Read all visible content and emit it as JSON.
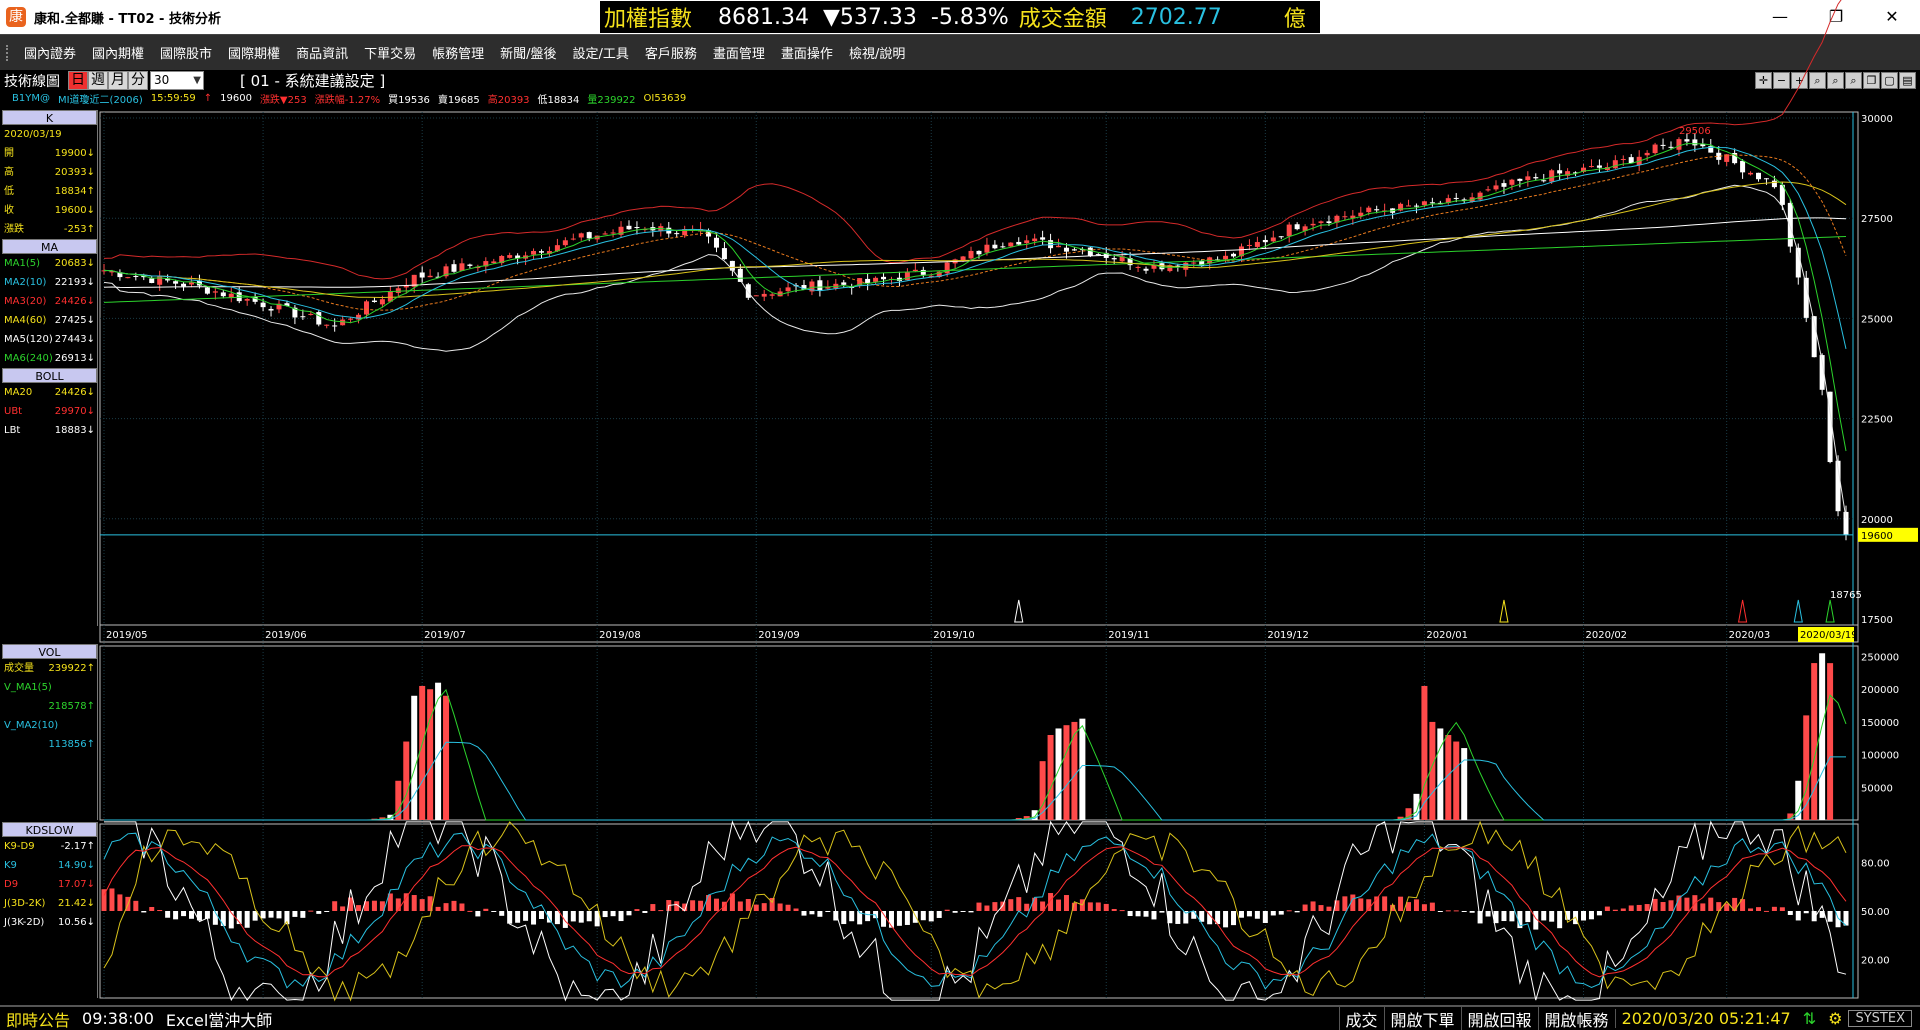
{
  "window": {
    "app_icon": "康",
    "title": "康和.全都賺 - TT02 - 技術分析",
    "minimize": "—",
    "maximize": "❐",
    "close": "✕"
  },
  "ticker": {
    "index_name": "加權指數",
    "index_value": "8681.34",
    "change": "▼537.33",
    "change_pct": "-5.83%",
    "turnover_label": "成交金額",
    "turnover_value": "2702.77",
    "unit": "億"
  },
  "menu": [
    "國內證券",
    "國內期權",
    "國際股市",
    "國際期權",
    "商品資訊",
    "下單交易",
    "帳務管理",
    "新聞/盤後",
    "設定/工具",
    "客戶服務",
    "畫面管理",
    "畫面操作",
    "檢視/說明"
  ],
  "toolbar": {
    "label": "技術線圖",
    "periods": [
      "日",
      "週",
      "月",
      "分"
    ],
    "active_period": "日",
    "select_value": "30",
    "setting_title": "[ 01 - 系統建議設定 ]"
  },
  "info": {
    "symbol": "B1YM@",
    "name": "MI道瓊近二(2006)",
    "time": "15:59:59",
    "arrow": "↑",
    "last": "19600",
    "change": "漲跌▼253",
    "change_pct": "漲跌幅-1.27%",
    "bid": "買19536",
    "ask": "賣19685",
    "high": "高20393",
    "low": "低18834",
    "volume": "量239922",
    "oi": "OI53639"
  },
  "panels": {
    "k": {
      "title": "K",
      "date": "2020/03/19",
      "rows": [
        {
          "k": "開",
          "v": "19900↓",
          "color": "#f5e21b"
        },
        {
          "k": "高",
          "v": "20393↓",
          "color": "#f5e21b"
        },
        {
          "k": "低",
          "v": "18834↑",
          "color": "#f5e21b"
        },
        {
          "k": "收",
          "v": "19600↓",
          "color": "#f5e21b"
        },
        {
          "k": "漲跌",
          "v": "-253↑",
          "color": "#f5e21b"
        }
      ]
    },
    "ma": {
      "title": "MA",
      "rows": [
        {
          "k": "MA1(5)",
          "v": "20683↓",
          "color": "#2cd32c",
          "vcolor": "#f5e21b"
        },
        {
          "k": "MA2(10)",
          "v": "22193↓",
          "color": "#29c0e0",
          "vcolor": "#fff"
        },
        {
          "k": "MA3(20)",
          "v": "24426↓",
          "color": "#ff3030",
          "vcolor": "#ff3030"
        },
        {
          "k": "MA4(60)",
          "v": "27425↓",
          "color": "#f5e21b",
          "vcolor": "#fff"
        },
        {
          "k": "MA5(120)",
          "v": "27443↓",
          "color": "#fff",
          "vcolor": "#fff"
        },
        {
          "k": "MA6(240)",
          "v": "26913↓",
          "color": "#2cd32c",
          "vcolor": "#fff"
        }
      ]
    },
    "boll": {
      "title": "BOLL",
      "rows": [
        {
          "k": "MA20",
          "v": "24426↓",
          "color": "#f5e21b",
          "vcolor": "#f5e21b"
        },
        {
          "k": "UBt",
          "v": "29970↓",
          "color": "#ff3030",
          "vcolor": "#ff3030"
        },
        {
          "k": "LBt",
          "v": "18883↓",
          "color": "#fff",
          "vcolor": "#fff"
        }
      ]
    },
    "vol": {
      "title": "VOL",
      "rows": [
        {
          "k": "成交量",
          "v": "239922↑",
          "color": "#f5e21b",
          "vcolor": "#f5e21b"
        },
        {
          "k": "V_MA1(5)",
          "v": "",
          "color": "#2cd32c",
          "vcolor": "#2cd32c"
        },
        {
          "k": "",
          "v": "218578↑",
          "color": "#2cd32c",
          "vcolor": "#2cd32c"
        },
        {
          "k": "V_MA2(10)",
          "v": "",
          "color": "#29c0e0",
          "vcolor": "#29c0e0"
        },
        {
          "k": "",
          "v": "113856↑",
          "color": "#29c0e0",
          "vcolor": "#29c0e0"
        }
      ]
    },
    "kd": {
      "title": "KDSLOW",
      "rows": [
        {
          "k": "K9-D9",
          "v": "-2.17↑",
          "color": "#f5e21b",
          "vcolor": "#fff"
        },
        {
          "k": "K9",
          "v": "14.90↓",
          "color": "#29c0e0",
          "vcolor": "#29c0e0"
        },
        {
          "k": "D9",
          "v": "17.07↓",
          "color": "#ff3030",
          "vcolor": "#ff3030"
        },
        {
          "k": "J(3D-2K)",
          "v": "21.42↓",
          "color": "#f5e21b",
          "vcolor": "#f5e21b"
        },
        {
          "k": "J(3K-2D)",
          "v": "10.56↓",
          "color": "#fff",
          "vcolor": "#fff"
        }
      ]
    }
  },
  "price_axis": [
    "30000",
    "27500",
    "25000",
    "22500",
    "20000",
    "17500"
  ],
  "price_flag": "19600",
  "price_low_label": "18765",
  "price_peak_label": "29506",
  "vol_axis": [
    "250000",
    "200000",
    "150000",
    "100000",
    "50000"
  ],
  "kd_axis": [
    "80.00",
    "50.00",
    "20.00"
  ],
  "dates": [
    "2019/05",
    "2019/06",
    "2019/07",
    "2019/08",
    "2019/09",
    "2019/10",
    "2019/11",
    "2019/12",
    "2020/01",
    "2020/02",
    "2020/03"
  ],
  "date_flag": "2020/03/19",
  "status": {
    "notice": "即時公告",
    "time": "09:38:00",
    "ad": "Excel當沖大師",
    "btn_trade": "成交",
    "btn_order": "開啟下單",
    "btn_report": "開啟回報",
    "btn_account": "開啟帳務",
    "clock": "2020/03/20 05:21:47",
    "logo": "SYSTEX"
  },
  "colors": {
    "up": "#ff4a4a",
    "down": "#ffffff",
    "grid": "#1a3b46"
  }
}
